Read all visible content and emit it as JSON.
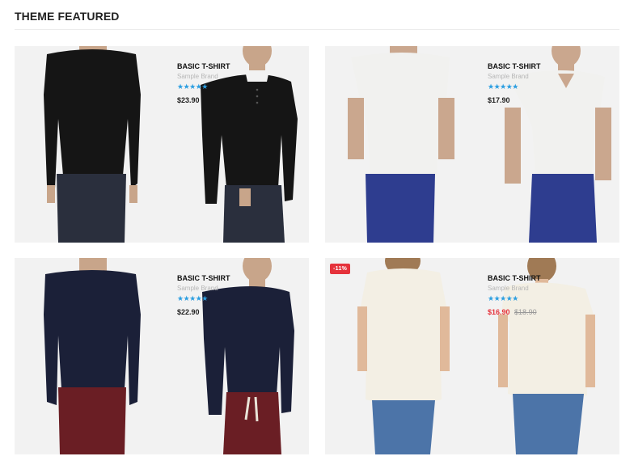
{
  "section": {
    "title": "THEME FEATURED"
  },
  "colors": {
    "accent_star": "#2d9fe1",
    "sale_red": "#e5323b",
    "card_bg": "#f2f2f2"
  },
  "products": [
    {
      "name": "BASIC T-SHIRT",
      "brand": "Sample Brand",
      "stars": "★★★★★",
      "rating": 5,
      "price": "$23.90",
      "shirt_color": "#151515",
      "pants_color": "#2a2f3d"
    },
    {
      "name": "BASIC T-SHIRT",
      "brand": "Sample Brand",
      "stars": "★★★★★",
      "rating": 5,
      "price": "$17.90",
      "shirt_color": "#f1f1ef",
      "pants_color": "#2e3d8f"
    },
    {
      "name": "BASIC T-SHIRT",
      "brand": "Sample Brand",
      "stars": "★★★★★",
      "rating": 5,
      "price": "$22.90",
      "shirt_color": "#1b2038",
      "pants_color": "#6a1e24"
    },
    {
      "name": "BASIC T-SHIRT",
      "brand": "Sample Brand",
      "stars": "★★★★★",
      "rating": 5,
      "price": "$16.90",
      "old_price": "$18.90",
      "badge": "-11%",
      "shirt_color": "#f3efe4",
      "pants_color": "#4c74a8"
    }
  ]
}
